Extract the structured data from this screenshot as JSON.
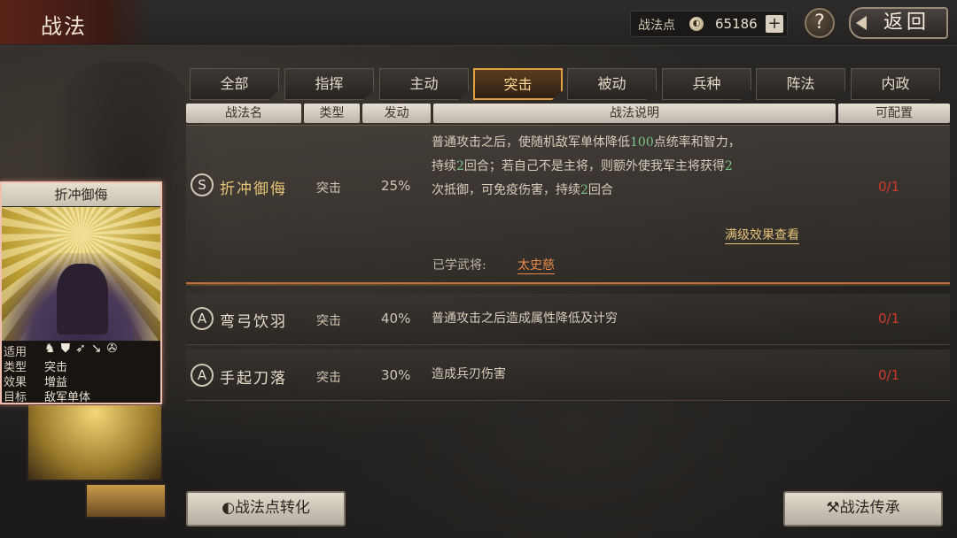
{
  "header": {
    "title": "战法",
    "points_label": "战法点",
    "points_value": "65186",
    "plus_label": "+",
    "help_label": "?",
    "back_label": "返回"
  },
  "tabs": [
    "全部",
    "指挥",
    "主动",
    "突击",
    "被动",
    "兵种",
    "阵法",
    "内政"
  ],
  "active_tab": "突击",
  "columns": [
    "战法名",
    "类型",
    "发动",
    "战法说明",
    "可配置"
  ],
  "tactics": [
    {
      "grade": "S",
      "name": "折冲御侮",
      "type": "突击",
      "rate": "25%",
      "desc_lines": [
        [
          "普通攻击之后，使随机敌军单体降低",
          "100",
          "点统率和智力，"
        ],
        [
          "持续",
          "2",
          "回合；若自己不是主将，则额外使我军主将获得",
          "2",
          ""
        ],
        [
          "次抵御，可免疫伤害，持续",
          "2",
          "回合"
        ]
      ],
      "detail_link": "满级效果查看",
      "learned_label": "已学武将:",
      "learned_by": "太史慈",
      "count": "0/1"
    },
    {
      "grade": "A",
      "name": "弯弓饮羽",
      "type": "突击",
      "rate": "40%",
      "desc": "普通攻击之后造成属性降低及计穷",
      "count": "0/1"
    },
    {
      "grade": "A",
      "name": "手起刀落",
      "type": "突击",
      "rate": "30%",
      "desc": "造成兵刃伤害",
      "count": "0/1"
    }
  ],
  "card": {
    "title": "折冲御侮",
    "rows": [
      {
        "label": "适用",
        "value": ""
      },
      {
        "label": "类型",
        "value": "突击"
      },
      {
        "label": "效果",
        "value": "增益"
      },
      {
        "label": "目标",
        "value": "敌军单体"
      }
    ],
    "unit_icons": [
      "cavalry-icon",
      "shield-icon",
      "bow-icon",
      "spear-icon",
      "siege-icon"
    ]
  },
  "buttons": {
    "convert": "战法点转化",
    "inherit": "战法传承"
  },
  "colors": {
    "accent_gold": "#e0a040",
    "highlight_green": "#7ec48a",
    "count_red": "#d03a2a",
    "learned_orange": "#e88a4a"
  }
}
